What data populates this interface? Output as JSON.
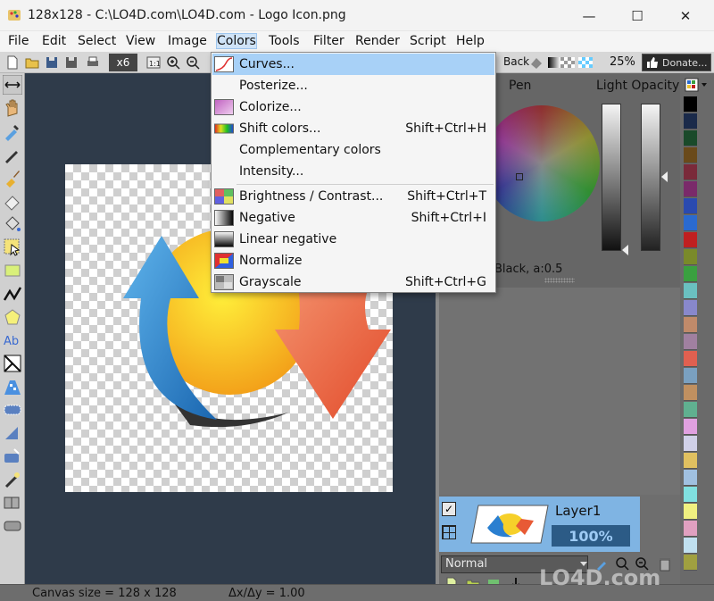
{
  "window": {
    "title": "128x128 - C:\\LO4D.com\\LO4D.com - Logo Icon.png"
  },
  "menubar": [
    {
      "label": "File",
      "key": "file"
    },
    {
      "label": "Edit",
      "key": "edit"
    },
    {
      "label": "Select",
      "key": "select"
    },
    {
      "label": "View",
      "key": "view"
    },
    {
      "label": "Image",
      "key": "image"
    },
    {
      "label": "Colors",
      "key": "colors"
    },
    {
      "label": "Tools",
      "key": "tools"
    },
    {
      "label": "Filter",
      "key": "filter"
    },
    {
      "label": "Render",
      "key": "render"
    },
    {
      "label": "Script",
      "key": "script"
    },
    {
      "label": "Help",
      "key": "help"
    }
  ],
  "toolbar": {
    "zoom_factor": "x6",
    "back_label": "Back",
    "zoom_percent": "25%",
    "donate_label": "Donate..."
  },
  "colors_menu": {
    "items": [
      {
        "label": "Curves...",
        "shortcut": "",
        "icon": "curves-icon",
        "highlighted": true
      },
      {
        "label": "Posterize...",
        "shortcut": "",
        "icon": ""
      },
      {
        "label": "Colorize...",
        "shortcut": "",
        "icon": "colorize-icon"
      },
      {
        "label": "Shift colors...",
        "shortcut": "Shift+Ctrl+H",
        "icon": "shift-colors-icon"
      },
      {
        "label": "Complementary colors",
        "shortcut": "",
        "icon": ""
      },
      {
        "label": "Intensity...",
        "shortcut": "",
        "icon": ""
      },
      {
        "label": "Brightness / Contrast...",
        "shortcut": "Shift+Ctrl+T",
        "icon": "brightness-contrast-icon"
      },
      {
        "label": "Negative",
        "shortcut": "Shift+Ctrl+I",
        "icon": "negative-icon"
      },
      {
        "label": "Linear negative",
        "shortcut": "",
        "icon": "linear-negative-icon"
      },
      {
        "label": "Normalize",
        "shortcut": "",
        "icon": "normalize-icon"
      },
      {
        "label": "Grayscale",
        "shortcut": "Shift+Ctrl+G",
        "icon": "grayscale-icon"
      }
    ]
  },
  "color_panel": {
    "pen_label": "Pen",
    "opacity_label": "Light Opacity",
    "readout": "Black, a:0.5"
  },
  "layers": {
    "layer_name": "Layer1",
    "opacity": "100%",
    "blend_mode": "Normal"
  },
  "palette": {
    "colors": [
      "#000000",
      "#1a2a4a",
      "#1a4a2a",
      "#6a4a1a",
      "#7a2a3a",
      "#7a2a6a",
      "#2a4ab0",
      "#2a6ad0",
      "#c02020",
      "#7a8a2a",
      "#3aa040",
      "#6ac0c0",
      "#8888cc",
      "#c08a6a",
      "#a080a0",
      "#e06050",
      "#7aa0c0",
      "#c09060",
      "#60b090",
      "#e0a0e0",
      "#d0d0e8",
      "#e0c060",
      "#a0c0e0",
      "#80e0e0",
      "#f0f080",
      "#e0a0c0",
      "#c0e0f0",
      "#a0a040"
    ]
  },
  "status": {
    "canvas_size": "Canvas size = 128 x 128",
    "delta": "Δx/Δy = 1.00"
  },
  "watermark": "LO4D.com"
}
